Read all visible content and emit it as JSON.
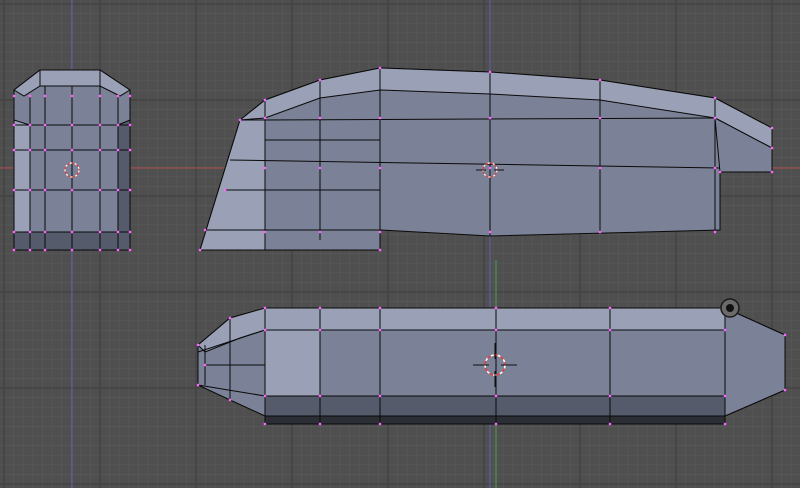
{
  "viewport": {
    "background_color": "#4f4f4f",
    "grid_minor_color": "#5a5a5a",
    "grid_major_color": "#3e3e3e",
    "axis_vertical_color": "#5f5fb0",
    "axis_horizontal_color": "#b04a4a",
    "axis_horizontal_green_color": "#4aa04a"
  },
  "mesh": {
    "face_color": "#7b8196",
    "face_light_color": "#9aa1b6",
    "face_dark_color": "#565b6c",
    "face_darkest_color": "#2c2e35",
    "edge_color": "#0a0a0a",
    "vertex_color": "#ff66ff"
  },
  "views": [
    {
      "name": "side-view",
      "icon": "mesh-object"
    },
    {
      "name": "front-view",
      "icon": "mesh-object"
    },
    {
      "name": "top-view",
      "icon": "mesh-object"
    }
  ],
  "cursor": {
    "icon": "3d-cursor-icon"
  },
  "origin": {
    "icon": "object-origin-icon"
  }
}
